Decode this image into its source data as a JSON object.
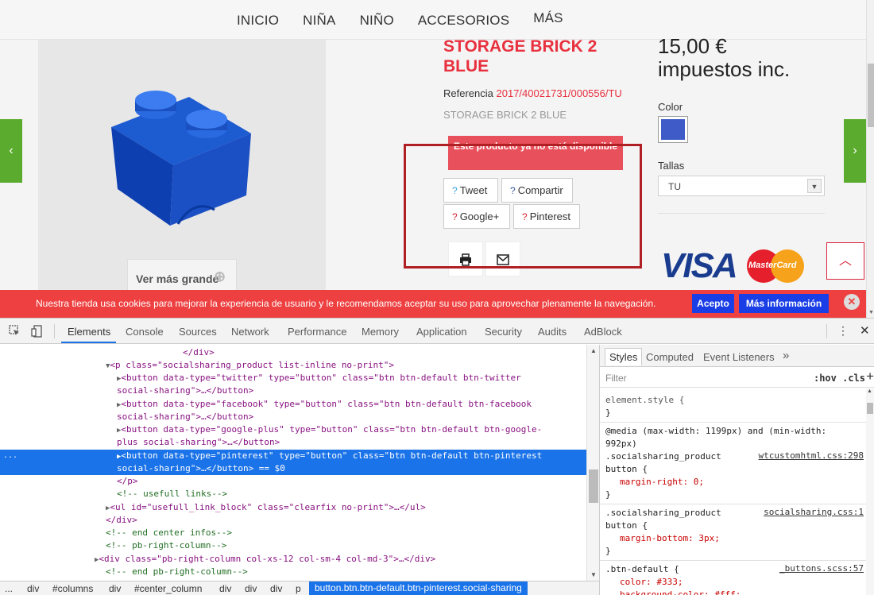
{
  "site": {
    "nav": [
      "INICIO",
      "NIÑA",
      "NIÑO",
      "ACCESORIOS",
      "MÁS"
    ],
    "product": {
      "title": "STORAGE BRICK 2 BLUE",
      "ref_label": "Referencia",
      "ref_value": "2017/40021731/000556/TU",
      "subtitle": "STORAGE BRICK 2 BLUE",
      "unavailable": "Este producto ya no está disponible",
      "price": "15,00 € impuestos inc.",
      "color_label": "Color",
      "size_label": "Tallas",
      "size_value": "TU",
      "view_larger": "Ver más grande",
      "color_swatch": "#3f5bc7"
    },
    "share": {
      "tweet": "Tweet",
      "compartir": "Compartir",
      "googleplus": "Google+",
      "pinterest": "Pinterest",
      "icon_glyph": "?"
    },
    "payment": {
      "visa": "VISA",
      "mastercard": "MasterCard"
    },
    "cookie": {
      "text": "Nuestra tienda usa cookies para mejorar la experiencia de usuario y le recomendamos aceptar su uso para aprovechar plenamente la navegación.",
      "accept": "Acepto",
      "more": "Más información"
    }
  },
  "devtools": {
    "tabs": [
      "Elements",
      "Console",
      "Sources",
      "Network",
      "Performance",
      "Memory",
      "Application",
      "Security",
      "Audits",
      "AdBlock"
    ],
    "active_tab": "Elements",
    "code": [
      "</div>",
      "<p class=\"socialsharing_product list-inline no-print\">",
      "<button data-type=\"twitter\" type=\"button\" class=\"btn btn-default btn-twitter",
      "social-sharing\">…</button>",
      "<button data-type=\"facebook\" type=\"button\" class=\"btn btn-default btn-facebook",
      "social-sharing\">…</button>",
      "<button data-type=\"google-plus\" type=\"button\" class=\"btn btn-default btn-google-",
      "plus social-sharing\">…</button>",
      "<button data-type=\"pinterest\" type=\"button\" class=\"btn btn-default btn-pinterest",
      "social-sharing\">…</button> == $0",
      "</p>",
      "<!-- usefull links-->",
      "<ul id=\"usefull_link_block\" class=\"clearfix no-print\">…</ul>",
      "</div>",
      "<!-- end center infos-->",
      "<!-- pb-right-column-->",
      "<div class=\"pb-right-column col-xs-12 col-sm-4 col-md-3\">…</div>",
      "<!-- end pb-right-column-->"
    ],
    "selected_marker": "...",
    "styles": {
      "tabs": [
        "Styles",
        "Computed",
        "Event Listeners",
        "»"
      ],
      "filter_placeholder": "Filter",
      "filter_tools": ":hov  .cls",
      "rules": [
        "element.style {",
        "}",
        "@media (max-width: 1199px) and (min-width:",
        "992px)",
        ".socialsharing_product",
        "button {",
        "margin-right: 0;",
        "}",
        ".socialsharing_product",
        "button {",
        "margin-bottom: 3px;",
        "}",
        ".btn-default {",
        "color: #333;",
        "background-color: #fff;"
      ],
      "sources": [
        "wtcustomhtml.css:298",
        "socialsharing.css:1",
        "_buttons.scss:57"
      ]
    },
    "breadcrumb": [
      "...",
      "div",
      "#columns",
      "div",
      "#center_column",
      "div",
      "div",
      "div",
      "p"
    ],
    "breadcrumb_selected": "button.btn.btn-default.btn-pinterest.social-sharing"
  }
}
